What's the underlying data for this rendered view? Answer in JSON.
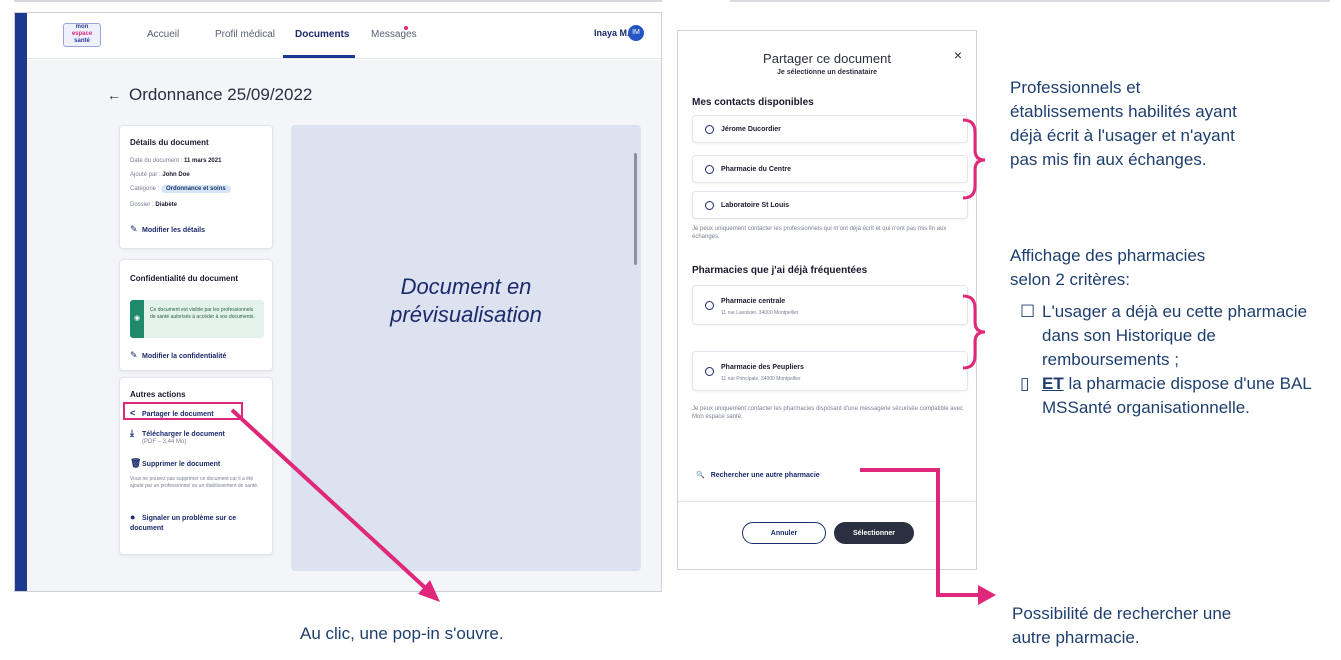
{
  "app": {
    "logo_line1": "mon",
    "logo_line2": "espace",
    "logo_line3": "santé",
    "nav": [
      "Accueil",
      "Profil médical",
      "Documents",
      "Messages"
    ],
    "user_name": "Inaya M.",
    "avatar_initials": "IM"
  },
  "document": {
    "title": "Ordonnance 25/09/2022",
    "details": {
      "title": "Détails du document",
      "date_label": "Date du document :",
      "date_value": "11 mars 2021",
      "added_label": "Ajouté par :",
      "added_value": "John Doe",
      "category_label": "Catégorie :",
      "category_value": "Ordonnance et soins",
      "folder_label": "Dossier :",
      "folder_value": "Diabète",
      "edit_link": "Modifier les détails"
    },
    "confidentiality": {
      "title": "Confidentialité du document",
      "notice": "Ce document est visible par les professionnels de santé autorisés à accéder à vos documents.",
      "edit_link": "Modifier la confidentialité"
    },
    "actions": {
      "title": "Autres actions",
      "share": "Partager le document",
      "download": "Télécharger le document",
      "download_meta": "(PDF – 3,44 Mo)",
      "delete": "Supprimer le document",
      "delete_note": "Vous ne pouvez pas supprimer ce document car il a été ajouté par un professionnel ou un établissement de santé.",
      "report": "Signaler un problème sur ce document"
    },
    "preview_line1": "Document en",
    "preview_line2": "prévisualisation"
  },
  "modal": {
    "title": "Partager ce document",
    "subtitle": "Je sélectionne un destinataire",
    "close": "×",
    "contacts_title": "Mes contacts disponibles",
    "contacts": [
      "Jérome Ducordier",
      "Pharmacie du Centre",
      "Laboratoire St Louis"
    ],
    "contacts_note": "Je peux uniquement contacter les professionnels qui m'ont déjà écrit et qui n'ont pas mis fin aux échanges.",
    "pharmacies_title": "Pharmacies que j'ai déjà fréquentées",
    "pharmacies": [
      {
        "name": "Pharmacie centrale",
        "address": "11 rue Lavoisier, 34000 Montpellier"
      },
      {
        "name": "Pharmacie des Peupliers",
        "address": "11 rue Principale, 34000 Montpellier"
      }
    ],
    "pharmacies_note": "Je peux uniquement contacter les pharmacies disposant d'une messagerie sécurisée compatible avec Mon espace santé.",
    "search_link": "Rechercher une autre pharmacie",
    "cancel": "Annuler",
    "select": "Sélectionner"
  },
  "annotations": {
    "contacts_note_1": "Professionnels et",
    "contacts_note_2": "établissements habilités ayant",
    "contacts_note_3": "déjà écrit à l'usager et n'ayant",
    "contacts_note_4": "pas mis fin aux échanges.",
    "pharmacies_heading_1": "Affichage des pharmacies",
    "pharmacies_heading_2": "selon 2 critères:",
    "criterion_1": "L'usager a déjà eu cette pharmacie dans son Historique de remboursements ;",
    "criterion_2_prefix": "ET",
    "criterion_2_rest": " la pharmacie dispose d'une BAL MSSanté organisationnelle.",
    "caption_left": "Au clic, une pop-in s'ouvre.",
    "caption_right_1": "Possibilité de rechercher une",
    "caption_right_2": "autre pharmacie."
  },
  "colors": {
    "brand_blue": "#1b3a8f",
    "accent_pink": "#e0287a",
    "annotation_text": "#1e3f6e"
  }
}
